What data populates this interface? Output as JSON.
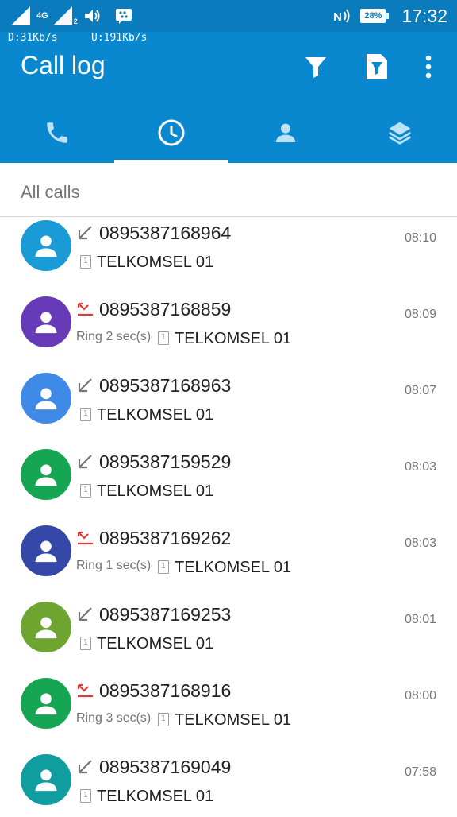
{
  "status_bar": {
    "network_type": "4G",
    "sim2_label": "2",
    "speed_down": "D:31Kb/s",
    "speed_up": "U:191Kb/s",
    "battery": "28%",
    "time": "17:32"
  },
  "appbar": {
    "title": "Call log"
  },
  "section": {
    "label": "All calls"
  },
  "calls": [
    {
      "number": "0895387168964",
      "ring": "",
      "sim": "1",
      "carrier": "TELKOMSEL 01",
      "time": "08:10",
      "type": "incoming",
      "avatar_color": "#1a9bd6"
    },
    {
      "number": "0895387168859",
      "ring": "Ring 2 sec(s)",
      "sim": "1",
      "carrier": "TELKOMSEL 01",
      "time": "08:09",
      "type": "missed",
      "avatar_color": "#673ab7"
    },
    {
      "number": "0895387168963",
      "ring": "",
      "sim": "1",
      "carrier": "TELKOMSEL 01",
      "time": "08:07",
      "type": "incoming",
      "avatar_color": "#3f8ae6"
    },
    {
      "number": "0895387159529",
      "ring": "",
      "sim": "1",
      "carrier": "TELKOMSEL 01",
      "time": "08:03",
      "type": "incoming",
      "avatar_color": "#16a552"
    },
    {
      "number": "0895387169262",
      "ring": "Ring 1 sec(s)",
      "sim": "1",
      "carrier": "TELKOMSEL 01",
      "time": "08:03",
      "type": "missed",
      "avatar_color": "#3548a8"
    },
    {
      "number": "0895387169253",
      "ring": "",
      "sim": "1",
      "carrier": "TELKOMSEL 01",
      "time": "08:01",
      "type": "incoming",
      "avatar_color": "#6ea531"
    },
    {
      "number": "0895387168916",
      "ring": "Ring 3 sec(s)",
      "sim": "1",
      "carrier": "TELKOMSEL 01",
      "time": "08:00",
      "type": "missed",
      "avatar_color": "#16a552"
    },
    {
      "number": "0895387169049",
      "ring": "",
      "sim": "1",
      "carrier": "TELKOMSEL 01",
      "time": "07:58",
      "type": "incoming",
      "avatar_color": "#0f9da0"
    }
  ],
  "colors": {
    "appbar": "#0a88cf",
    "missed": "#e53935",
    "incoming_arrow": "#757575"
  }
}
